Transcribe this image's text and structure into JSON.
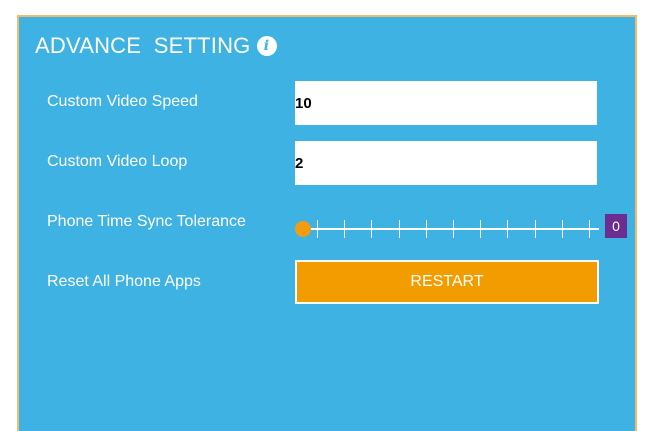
{
  "title": {
    "text": "ADVANCE  SETTING",
    "icon": "info-icon",
    "icon_glyph": "i"
  },
  "settings": {
    "video_speed": {
      "label": "Custom Video Speed",
      "value": "10"
    },
    "video_loop": {
      "label": "Custom Video Loop",
      "value": "2"
    },
    "time_sync": {
      "label": "Phone Time Sync Tolerance",
      "value": "0",
      "min": 0,
      "max": 10,
      "ticks": 11
    },
    "reset_apps": {
      "label": "Reset All Phone Apps",
      "button_label": "RESTART"
    }
  },
  "colors": {
    "panel_background": "#3db2e3",
    "panel_border": "#f0bb6a",
    "accent_orange": "#f39c00",
    "value_badge": "#6b2d8f",
    "text": "#ffffff"
  }
}
